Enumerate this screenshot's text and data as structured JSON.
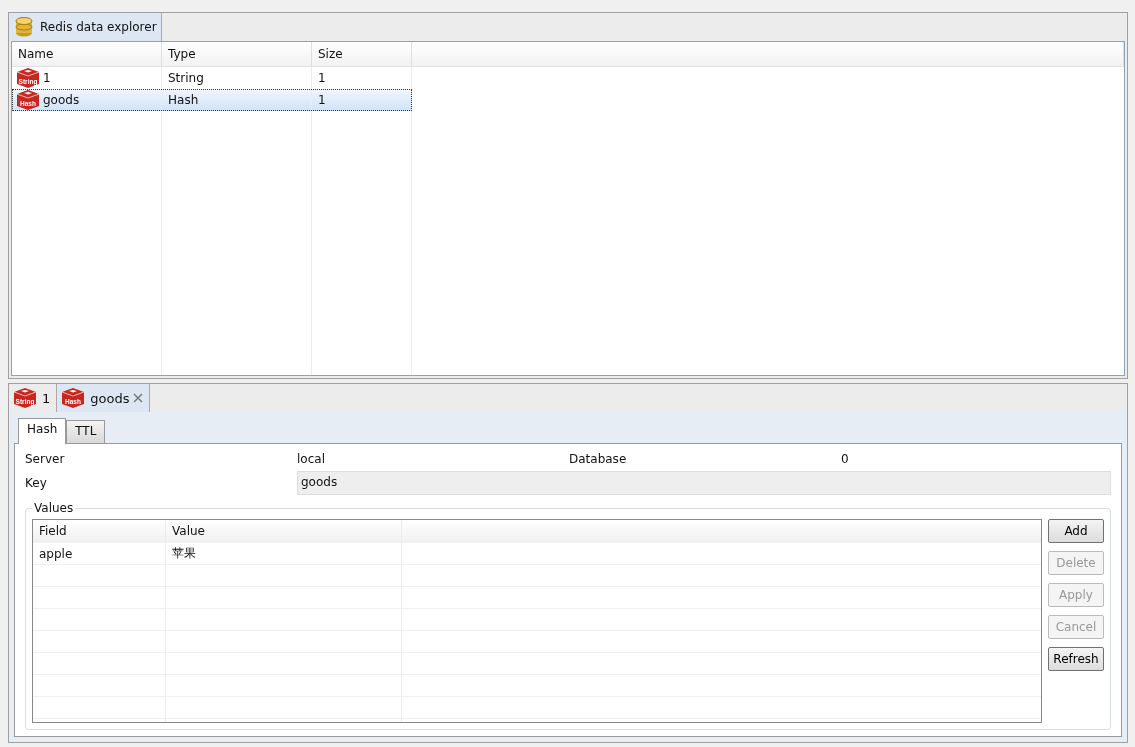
{
  "explorer": {
    "tab": {
      "label": "Redis data explorer",
      "selected": true
    },
    "columns": [
      "Name",
      "Type",
      "Size"
    ],
    "rows": [
      {
        "icon_label": "String",
        "name": "1",
        "type": "String",
        "size": "1",
        "selected": false
      },
      {
        "icon_label": "Hash",
        "name": "goods",
        "type": "Hash",
        "size": "1",
        "selected": true
      }
    ]
  },
  "editor_tabs": [
    {
      "icon_label": "String",
      "label": "1",
      "selected": false,
      "closable": false
    },
    {
      "icon_label": "Hash",
      "label": "goods",
      "selected": true,
      "closable": true
    }
  ],
  "inner_tabs": [
    {
      "label": "Hash",
      "selected": true
    },
    {
      "label": "TTL",
      "selected": false
    }
  ],
  "form": {
    "server_label": "Server",
    "server": "local",
    "database_label": "Database",
    "database": "0",
    "key_label": "Key",
    "key": "goods"
  },
  "values": {
    "title": "Values",
    "columns": [
      "Field",
      "Value"
    ],
    "rows": [
      {
        "field": "apple",
        "value": "苹果"
      }
    ],
    "buttons": [
      {
        "label": "Add",
        "disabled": false
      },
      {
        "label": "Delete",
        "disabled": true
      },
      {
        "label": "Apply",
        "disabled": true
      },
      {
        "label": "Cancel",
        "disabled": true
      },
      {
        "label": "Refresh",
        "disabled": false
      }
    ]
  }
}
